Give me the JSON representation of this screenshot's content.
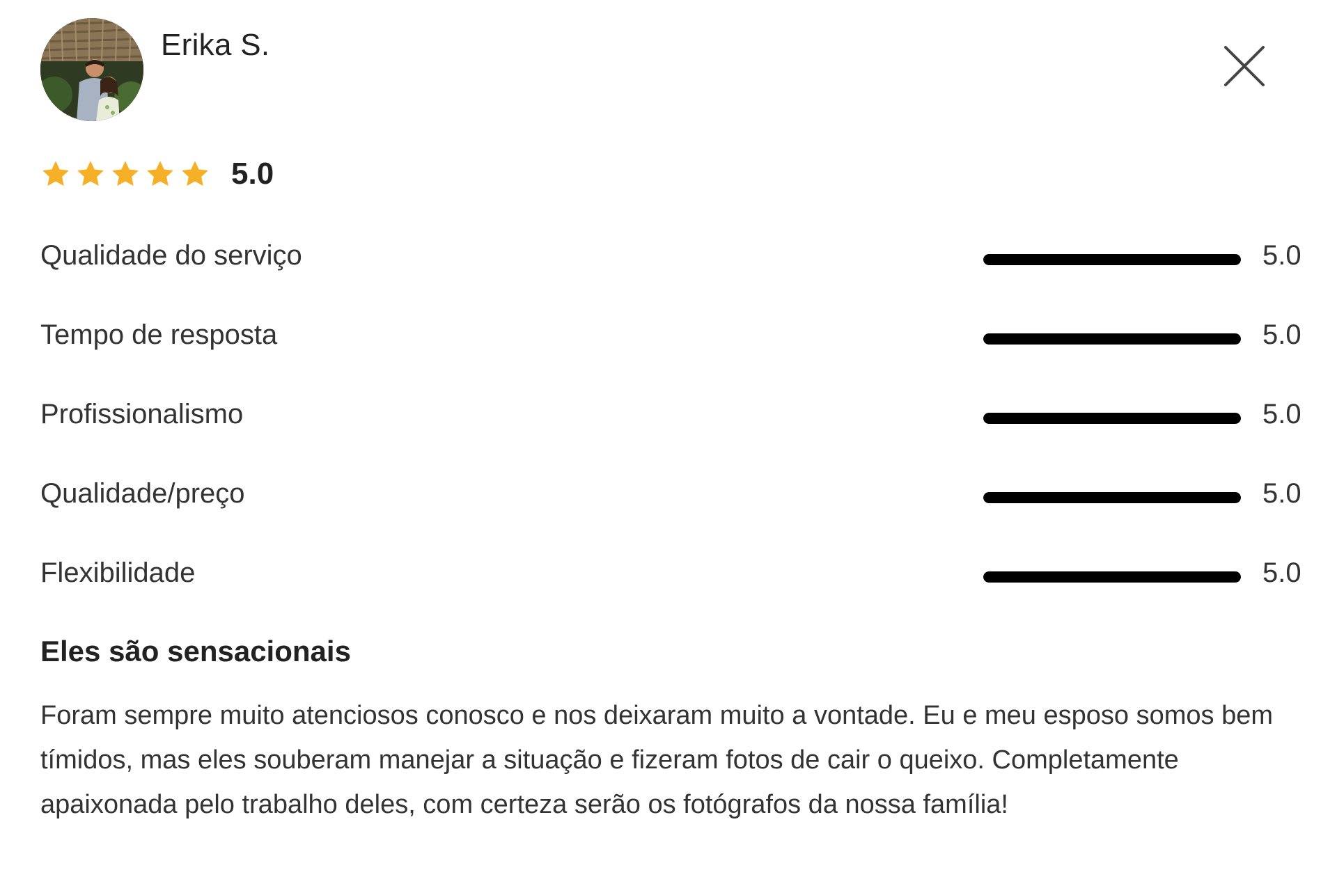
{
  "reviewer": {
    "name": "Erika S.",
    "avatar_icon": "couple-photo-avatar"
  },
  "close_icon": "close-icon",
  "rating": {
    "stars": 5,
    "max_stars": 5,
    "score": "5.0",
    "star_color": "#F5B027"
  },
  "criteria": [
    {
      "label": "Qualidade do serviço",
      "value": "5.0",
      "fill": 1.0
    },
    {
      "label": "Tempo de resposta",
      "value": "5.0",
      "fill": 1.0
    },
    {
      "label": "Profissionalismo",
      "value": "5.0",
      "fill": 1.0
    },
    {
      "label": "Qualidade/preço",
      "value": "5.0",
      "fill": 1.0
    },
    {
      "label": "Flexibilidade",
      "value": "5.0",
      "fill": 1.0
    }
  ],
  "review": {
    "title": "Eles são sensacionais",
    "body": "Foram sempre muito atenciosos conosco e nos deixaram muito a vontade. Eu e meu esposo somos bem tímidos, mas eles souberam manejar a situação e fizeram fotos de cair o queixo. Completamente apaixonada pelo trabalho deles, com certeza serão os fotógrafos da nossa família!"
  }
}
